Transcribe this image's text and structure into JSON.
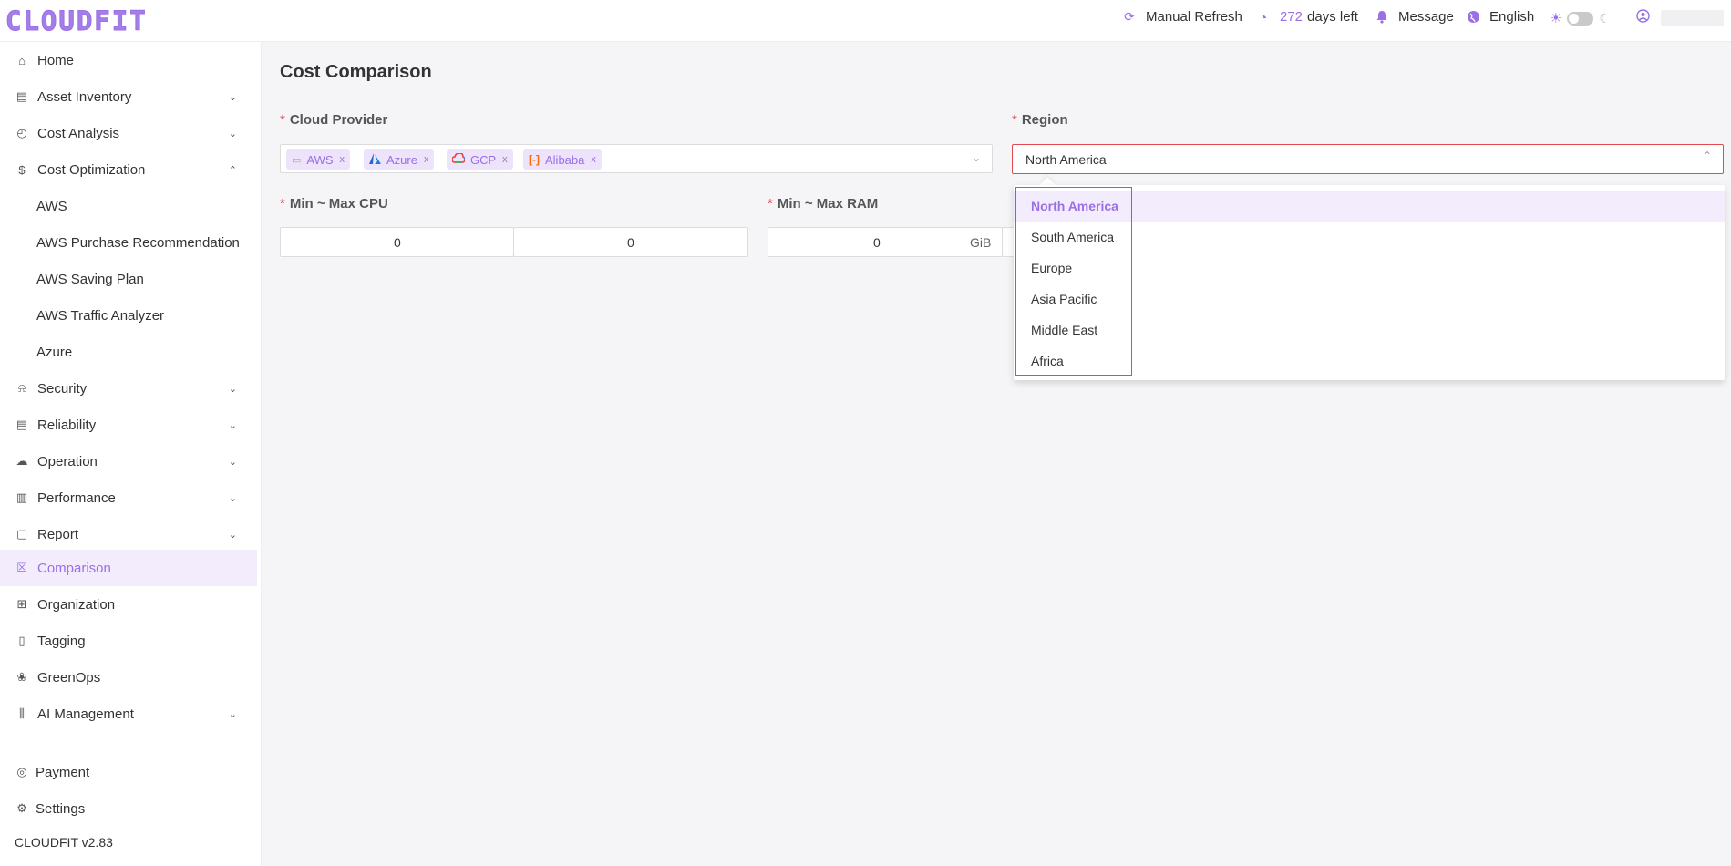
{
  "header": {
    "logo": "CLOUDFIT",
    "manual_refresh": "Manual Refresh",
    "days_count": "272",
    "days_label": "days left",
    "message": "Message",
    "language": "English"
  },
  "sidebar": {
    "items": [
      {
        "label": "Home",
        "icon": "home-icon"
      },
      {
        "label": "Asset Inventory",
        "icon": "inventory-icon"
      },
      {
        "label": "Cost Analysis",
        "icon": "gauge-icon"
      },
      {
        "label": "Cost Optimization",
        "icon": "dollar-icon"
      },
      {
        "label": "AWS"
      },
      {
        "label": "AWS Purchase Recommendation"
      },
      {
        "label": "AWS Saving Plan"
      },
      {
        "label": "AWS Traffic Analyzer"
      },
      {
        "label": "Azure"
      },
      {
        "label": "Security",
        "icon": "alarm-icon"
      },
      {
        "label": "Reliability",
        "icon": "reliability-icon"
      },
      {
        "label": "Operation",
        "icon": "operation-icon"
      },
      {
        "label": "Performance",
        "icon": "performance-icon"
      },
      {
        "label": "Report",
        "icon": "report-icon"
      },
      {
        "label": "Comparison",
        "icon": "comparison-icon"
      },
      {
        "label": "Organization",
        "icon": "org-icon"
      },
      {
        "label": "Tagging",
        "icon": "tag-icon"
      },
      {
        "label": "GreenOps",
        "icon": "greenops-icon"
      },
      {
        "label": "AI Management",
        "icon": "ai-icon"
      }
    ],
    "payment": "Payment",
    "settings": "Settings",
    "version": "CLOUDFIT v2.83"
  },
  "main": {
    "title": "Cost Comparison",
    "cloud_provider_label": "Cloud Provider",
    "region_label": "Region",
    "cpu_label": "Min ~ Max CPU",
    "ram_label": "Min ~ Max RAM",
    "required_mark": "*",
    "providers": [
      {
        "label": "AWS"
      },
      {
        "label": "Azure"
      },
      {
        "label": "GCP"
      },
      {
        "label": "Alibaba"
      }
    ],
    "remove_mark": "x",
    "region_value": "North America",
    "cpu_min": "0",
    "cpu_max": "0",
    "ram_min": "0",
    "ram_unit": "GiB"
  },
  "region_dropdown": {
    "options": [
      "North America",
      "South America",
      "Europe",
      "Asia Pacific",
      "Middle East",
      "Africa"
    ],
    "selected": "North America"
  },
  "colors": {
    "accent": "#9b6fe6",
    "required": "#e5484d",
    "active_bg": "#f3ecfd"
  }
}
